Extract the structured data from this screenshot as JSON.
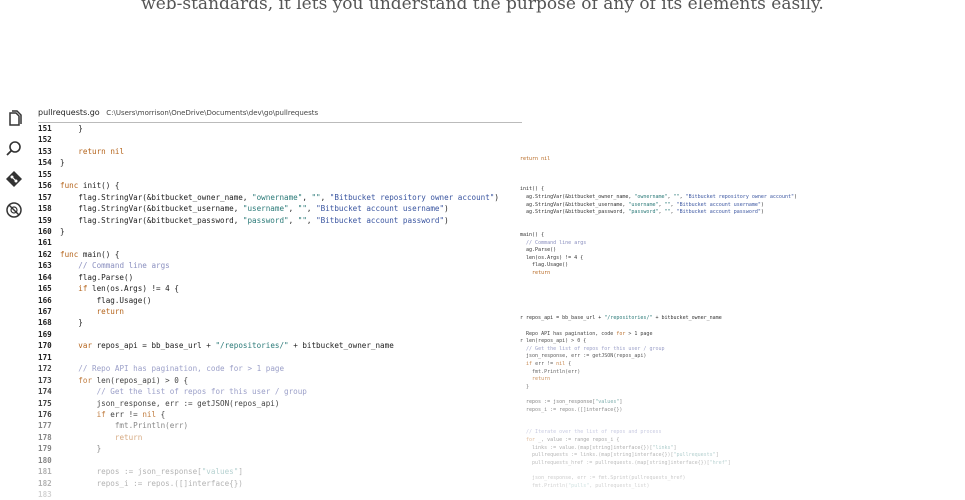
{
  "hero": {
    "text": "web-standards, it lets you understand the purpose of any of its elements easily."
  },
  "tab": {
    "filename": "pullrequests.go",
    "path": "C:\\Users\\morrison\\OneDrive\\Documents\\dev\\go\\pullrequests"
  },
  "activity_icons": [
    "files-icon",
    "search-icon",
    "source-control-icon",
    "debug-icon"
  ],
  "code_lines": [
    {
      "n": "151",
      "t": "    }",
      "c": ""
    },
    {
      "n": "152",
      "t": "",
      "c": ""
    },
    {
      "n": "153",
      "t": "    return nil",
      "c": ""
    },
    {
      "n": "154",
      "t": "}",
      "c": ""
    },
    {
      "n": "155",
      "t": "",
      "c": ""
    },
    {
      "n": "156",
      "t": "func init() {",
      "c": ""
    },
    {
      "n": "157",
      "t": "    flag.StringVar(&bitbucket_owner_name, \"ownername\", \"\", \"Bitbucket repository owner account\")",
      "c": ""
    },
    {
      "n": "158",
      "t": "    flag.StringVar(&bitbucket_username, \"username\", \"\", \"Bitbucket account username\")",
      "c": ""
    },
    {
      "n": "159",
      "t": "    flag.StringVar(&bitbucket_password, \"password\", \"\", \"Bitbucket account password\")",
      "c": ""
    },
    {
      "n": "160",
      "t": "}",
      "c": ""
    },
    {
      "n": "161",
      "t": "",
      "c": ""
    },
    {
      "n": "162",
      "t": "func main() {",
      "c": ""
    },
    {
      "n": "163",
      "t": "    // Command line args",
      "c": ""
    },
    {
      "n": "164",
      "t": "    flag.Parse()",
      "c": ""
    },
    {
      "n": "165",
      "t": "    if len(os.Args) != 4 {",
      "c": ""
    },
    {
      "n": "166",
      "t": "        flag.Usage()",
      "c": ""
    },
    {
      "n": "167",
      "t": "        return",
      "c": ""
    },
    {
      "n": "168",
      "t": "    }",
      "c": ""
    },
    {
      "n": "169",
      "t": "",
      "c": ""
    },
    {
      "n": "170",
      "t": "    var repos_api = bb_base_url + \"/repositories/\" + bitbucket_owner_name",
      "c": ""
    },
    {
      "n": "171",
      "t": "",
      "c": ""
    },
    {
      "n": "172",
      "t": "    // Repo API has pagination, code for > 1 page",
      "c": "fade1"
    },
    {
      "n": "173",
      "t": "    for len(repos_api) > 0 {",
      "c": "fade1"
    },
    {
      "n": "174",
      "t": "        // Get the list of repos for this user / group",
      "c": "fade1"
    },
    {
      "n": "175",
      "t": "        json_response, err := getJSON(repos_api)",
      "c": "fade1"
    },
    {
      "n": "176",
      "t": "        if err != nil {",
      "c": "fade1"
    },
    {
      "n": "177",
      "t": "            fmt.Println(err)",
      "c": "fade2"
    },
    {
      "n": "178",
      "t": "            return",
      "c": "fade2"
    },
    {
      "n": "179",
      "t": "        }",
      "c": "fade2"
    },
    {
      "n": "180",
      "t": "",
      "c": "fade2"
    },
    {
      "n": "181",
      "t": "        repos := json_response[\"values\"]",
      "c": "fade3"
    },
    {
      "n": "182",
      "t": "        repos_i := repos.([]interface{})",
      "c": "fade3"
    },
    {
      "n": "183",
      "t": "",
      "c": "fade4"
    }
  ],
  "minimap_lines": [
    "return nil",
    "",
    "",
    "",
    "init() {",
    "  ag.StringVar(&bitbucket_owner_name, \"ownername\", \"\", \"Bitbucket repository owner account\")",
    "  ag.StringVar(&bitbucket_username, \"username\", \"\", \"Bitbucket account username\")",
    "  ag.StringVar(&bitbucket_password, \"password\", \"\", \"Bitbucket account password\")",
    "",
    "",
    "main() {",
    "  // Command line args",
    "  ag.Parse()",
    "  len(os.Args) != 4 {",
    "    flag.Usage()",
    "    return",
    "",
    "",
    "",
    "",
    "",
    "r repos_api = bb_base_url + \"/repositories/\" + bitbucket_owner_name",
    "",
    "  Repo API has pagination, code for > 1 page",
    "r len(repos_api) > 0 {",
    "  // Get the list of repos for this user / group",
    "  json_response, err := getJSON(repos_api)",
    "  if err != nil {",
    "    fmt.Println(err)",
    "    return",
    "  }",
    "",
    "  repos := json_response[\"values\"]",
    "  repos_i := repos.([]interface{})",
    "",
    "",
    "  // Iterate over the list of repos and process",
    "  for _, value := range repos_i {",
    "    links := value.(map[string]interface{})[\"links\"]",
    "    pullrequests := links.(map[string]interface{})[\"pullrequests\"]",
    "    pullrequests_href := pullrequests.(map[string]interface{})[\"href\"]",
    "",
    "    json_response, err := fmt.Sprint(pullrequests_href)",
    "    fmt.Println(\"pulls\", pullrequests_list)"
  ]
}
